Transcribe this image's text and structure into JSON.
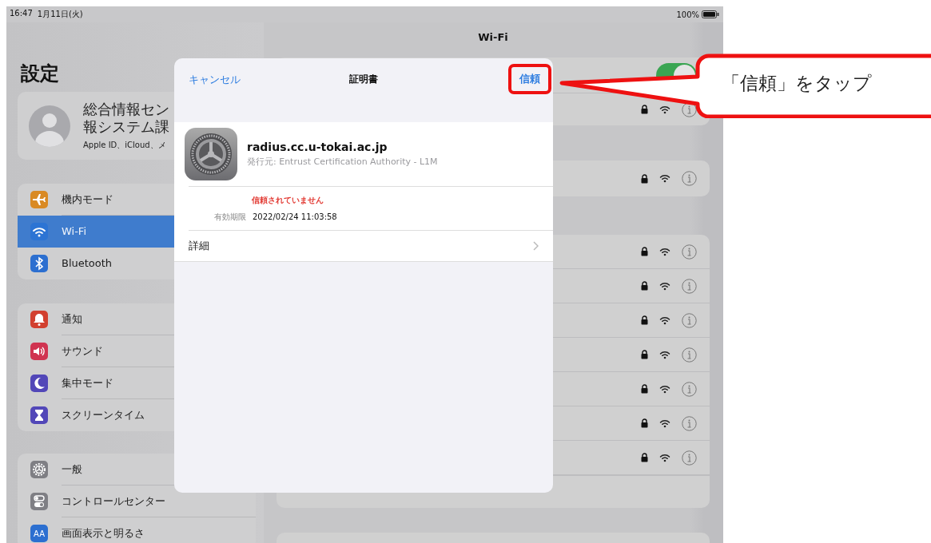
{
  "status_bar": {
    "time": "16:47",
    "date": "1月11日(火)",
    "battery": "100%"
  },
  "sidebar": {
    "title": "設定",
    "profile": {
      "name_line_1": "総合情報セン",
      "name_line_2": "報システム課",
      "subtitle": "Apple ID、iCloud、メ"
    },
    "groups": [
      {
        "items": [
          {
            "kind": "airplane",
            "label": "機内モード",
            "color": "#d98a24",
            "selected": false
          },
          {
            "kind": "wifi",
            "label": "Wi-Fi",
            "color": "#2c74d4",
            "selected": true
          },
          {
            "kind": "bluetooth",
            "label": "Bluetooth",
            "color": "#2c6fd0",
            "selected": false
          }
        ]
      },
      {
        "items": [
          {
            "kind": "bell",
            "label": "通知",
            "color": "#d2402f",
            "selected": false
          },
          {
            "kind": "speaker",
            "label": "サウンド",
            "color": "#d03350",
            "selected": false
          },
          {
            "kind": "moon",
            "label": "集中モード",
            "color": "#5247b8",
            "selected": false
          },
          {
            "kind": "hourglass",
            "label": "スクリーンタイム",
            "color": "#5247b8",
            "selected": false
          }
        ]
      },
      {
        "items": [
          {
            "kind": "gear",
            "label": "一般",
            "color": "#7f7f84",
            "selected": false
          },
          {
            "kind": "toggles",
            "label": "コントロールセンター",
            "color": "#7f7f84",
            "selected": false
          },
          {
            "kind": "text",
            "icon_text": "AA",
            "label": "画面表示と明るさ",
            "color": "#2c6fd0",
            "selected": false
          }
        ]
      }
    ]
  },
  "detail": {
    "title": "Wi-Fi",
    "wifi_on": true,
    "networks": [
      {
        "locked": true
      },
      {
        "locked": true
      },
      {
        "locked": true
      },
      {
        "locked": true
      },
      {
        "locked": true
      },
      {
        "locked": true
      },
      {
        "locked": true
      },
      {
        "locked": true
      },
      {
        "locked": true
      }
    ]
  },
  "sheet": {
    "cancel": "キャンセル",
    "title": "証明書",
    "trust": "信頼",
    "certificate": {
      "name": "radius.cc.u-tokai.ac.jp",
      "issuer": "発行元: Entrust Certification Authority - L1M",
      "status": "信頼されていません",
      "expiry_label": "有効期限",
      "expiry": "2022/02/24 11:03:58"
    },
    "details_row": "詳細"
  },
  "annotation": {
    "callout": "「信頼」をタップ"
  }
}
